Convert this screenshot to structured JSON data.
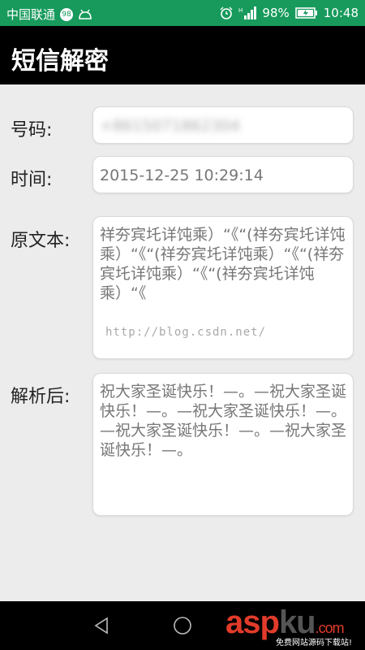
{
  "status_bar": {
    "carrier": "中国联通",
    "carrier_badge": "98",
    "battery_percent": "98%",
    "time": "10:48"
  },
  "app_bar": {
    "title": "短信解密"
  },
  "form": {
    "number_label": "号码:",
    "number_value": "+8615071862304",
    "time_label": "时间:",
    "time_value": "2015-12-25 10:29:14",
    "original_label": "原文本:",
    "original_value": "祥夯宾圫详饨乘）“《“(祥夯宾圫详饨乘）“《“(祥夯宾圫详饨乘）“《“(祥夯宾圫详饨乘）“《“(祥夯宾圫详饨乘）“《",
    "parsed_label": "解析后:",
    "parsed_value": "祝大家圣诞快乐！—。—祝大家圣诞快乐！—。—祝大家圣诞快乐！—。—祝大家圣诞快乐！—。—祝大家圣诞快乐！—。"
  },
  "watermark": "http://blog.csdn.net/",
  "site_logo": {
    "brand_red": "asp",
    "brand_dark": "ku",
    "tld": ".com",
    "slogan": "免费网站源码下载站!"
  },
  "colors": {
    "status_bar": "#179a5c",
    "app_bar": "#000000",
    "background": "#ececec",
    "logo_red": "#e23b2a"
  }
}
